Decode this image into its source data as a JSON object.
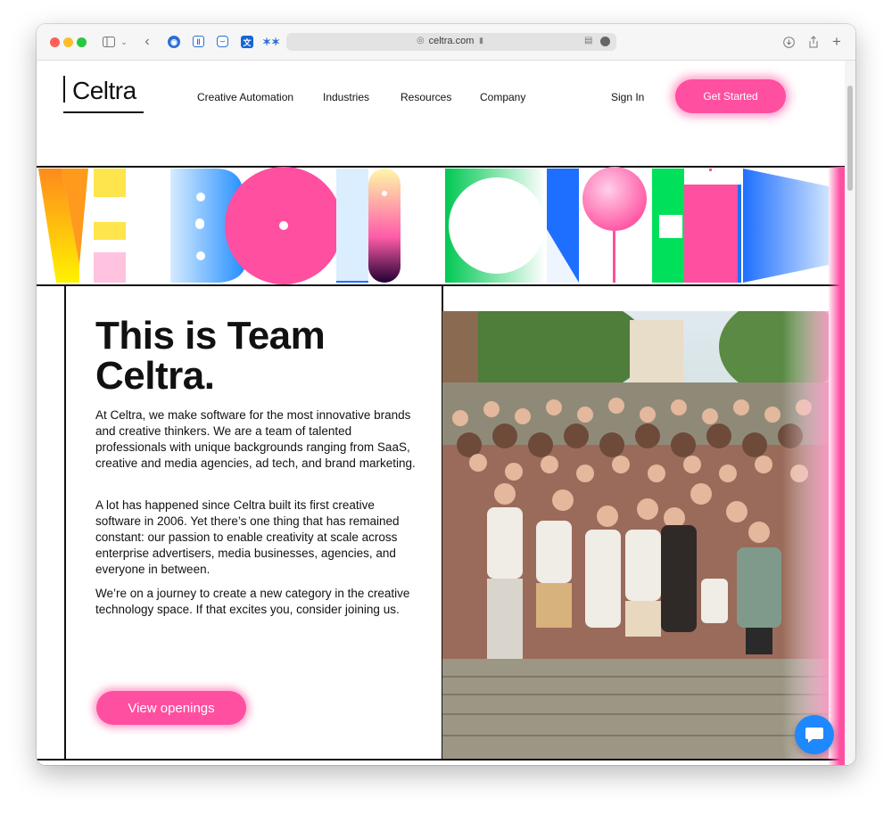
{
  "browser": {
    "url": "celtra.com",
    "icons": [
      "sidebar-icon",
      "back-icon",
      "extension-icons",
      "globe-icon",
      "lock-icon",
      "reader-icon",
      "download-icon",
      "share-icon",
      "new-tab-icon"
    ]
  },
  "header": {
    "logo": "Celtra",
    "nav": [
      "Creative Automation",
      "Industries",
      "Resources",
      "Company"
    ],
    "sign_in": "Sign In",
    "cta": "Get Started"
  },
  "colors": {
    "accent": "#ff4fa0",
    "text": "#111111",
    "chat": "#1e88ff"
  },
  "main": {
    "title": "This is Team Celtra.",
    "paragraphs": [
      "At Celtra, we make software for the most innovative brands and creative thinkers. We are a team of talented professionals with unique backgrounds ranging from SaaS, creative and media agencies, ad tech, and brand marketing.",
      "A lot has happened since Celtra built its first creative software in 2006. Yet there’s one thing that has remained constant: our passion to enable creativity at scale across enterprise advertisers, media businesses, agencies, and everyone in between.",
      "We’re on a journey to create a new category in the creative technology space. If that excites you, consider joining us."
    ],
    "button": "View openings"
  }
}
